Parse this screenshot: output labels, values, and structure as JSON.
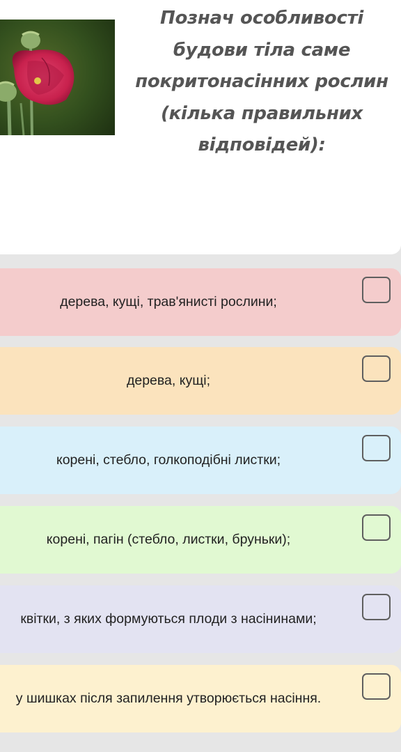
{
  "question": {
    "lines": [
      "Познач особливості",
      "будови тіла саме",
      "покритонасінних рослин",
      "(кілька правильних",
      "відповідей):"
    ]
  },
  "image": {
    "subject": "poppy-flower-photo"
  },
  "options": [
    {
      "label": "дерева, кущі, трав'янисті рослини;",
      "color": "#f4cccc",
      "checked": false
    },
    {
      "label": "дерева, кущі;",
      "color": "#fbe3bd",
      "checked": false
    },
    {
      "label": "корені, стебло, голкоподібні листки;",
      "color": "#d9f0fa",
      "checked": false
    },
    {
      "label": "корені, пагін (стебло, листки, бруньки);",
      "color": "#e1f9d2",
      "checked": false
    },
    {
      "label": "квітки, з яких формуються плоди з насінинами;",
      "color": "#e3e3f2",
      "checked": false
    },
    {
      "label": "у шишках після запилення утворюється насіння.",
      "color": "#fdf1cf",
      "checked": false
    }
  ],
  "colors": {
    "page_background": "#e6e6e6",
    "card_background": "#ffffff",
    "question_text": "#555555",
    "option_text": "#222222",
    "checkbox_border": "#5f5f5f"
  }
}
